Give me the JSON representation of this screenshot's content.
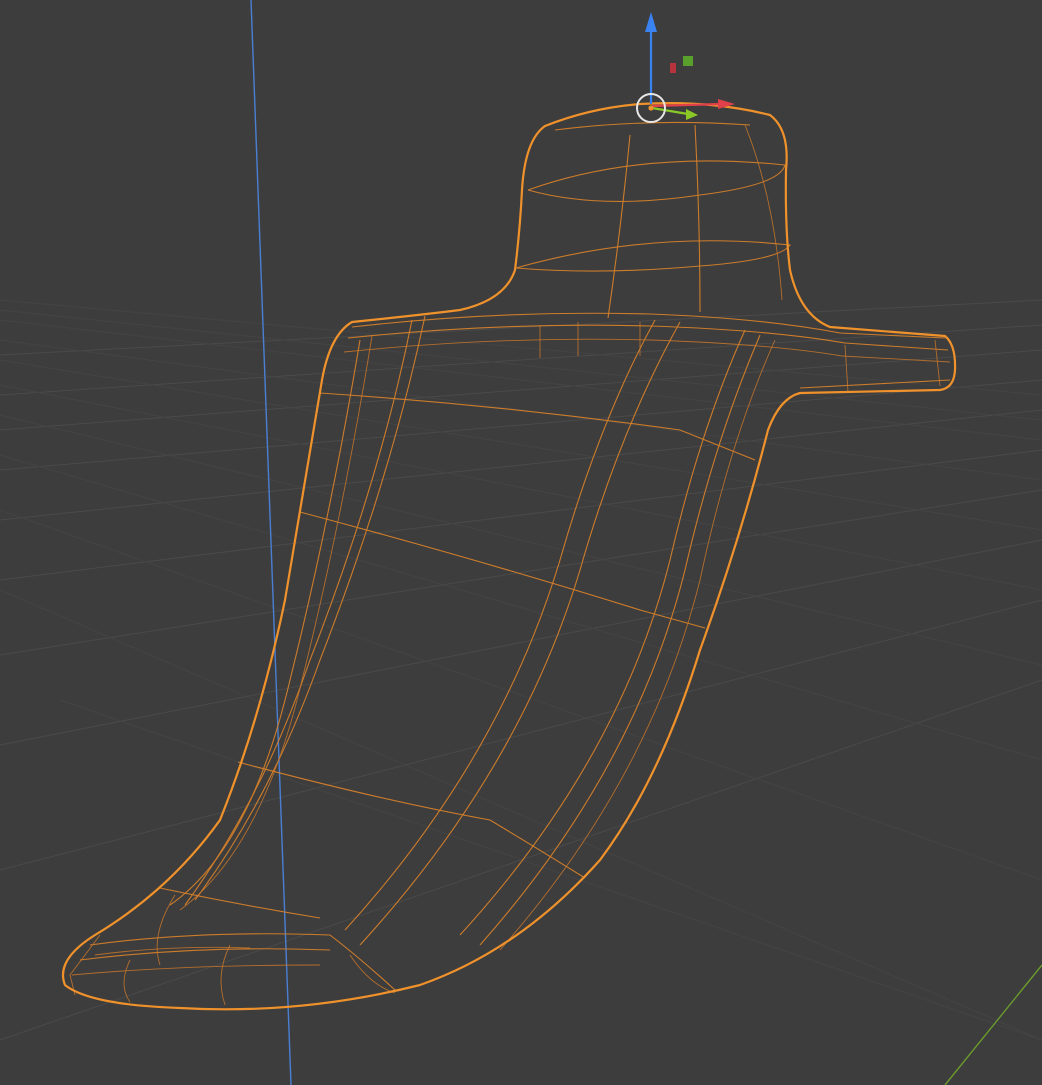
{
  "viewport": {
    "type": "3d-viewport",
    "display_mode": "wireframe",
    "background_color": "#3d3d3d",
    "grid_color": "#4a4a4a",
    "selection_outline_color": "#f0922c",
    "wire_color": "#d47f2a"
  },
  "axes": {
    "z_axis_color": "#4a7fd4",
    "y_axis_color": "#6b9a2c"
  },
  "gizmo": {
    "x_arrow_color": "#e0404a",
    "y_arrow_color": "#8ac926",
    "z_arrow_color": "#3a82f0",
    "plane_handles": [
      "red-plane-handle",
      "green-plane-handle"
    ]
  },
  "object": {
    "name_icon": "surf-fin-mesh",
    "selected": true
  }
}
